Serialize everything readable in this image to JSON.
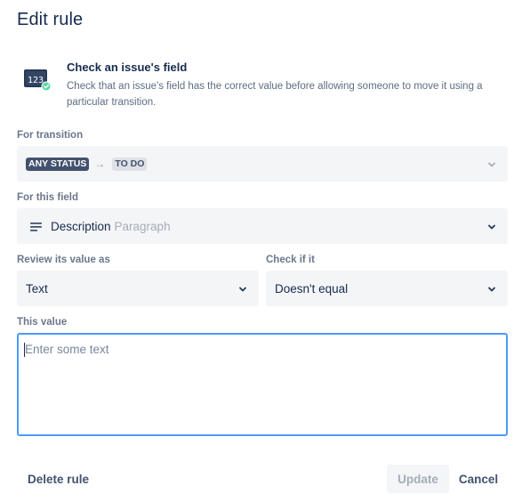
{
  "dialog": {
    "title": "Edit rule"
  },
  "rule": {
    "name": "Check an issue's field",
    "description": "Check that an issue's field has the correct value before allowing someone to move it using a particular transition.",
    "icon": "field-check-icon"
  },
  "transition": {
    "label": "For transition",
    "from": "ANY STATUS",
    "arrow": "→",
    "to": "TO DO"
  },
  "field": {
    "label": "For this field",
    "name": "Description",
    "type": "Paragraph",
    "icon": "paragraph-icon"
  },
  "review": {
    "label": "Review its value as",
    "value": "Text"
  },
  "check": {
    "label": "Check if it",
    "value": "Doesn't equal"
  },
  "value_input": {
    "label": "This value",
    "placeholder": "Enter some text",
    "value": ""
  },
  "footer": {
    "delete_label": "Delete rule",
    "update_label": "Update",
    "cancel_label": "Cancel"
  },
  "colors": {
    "focus_border": "#4c9aff",
    "field_bg": "#f4f5f7",
    "text": "#172b4d",
    "lozenge_dark": "#42526e"
  }
}
